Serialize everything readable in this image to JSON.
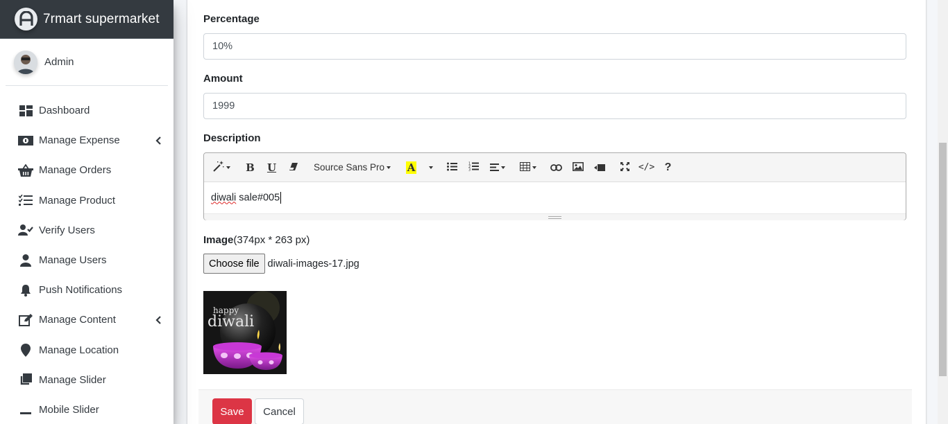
{
  "app": {
    "brand_name": "7rmart supermarket",
    "user_name": "Admin"
  },
  "sidebar": {
    "items": [
      {
        "label": "Dashboard",
        "icon": "dashboard-icon",
        "has_submenu": false
      },
      {
        "label": "Manage Expense",
        "icon": "money-icon",
        "has_submenu": true
      },
      {
        "label": "Manage Orders",
        "icon": "basket-icon",
        "has_submenu": false
      },
      {
        "label": "Manage Product",
        "icon": "tasks-list-icon",
        "has_submenu": false
      },
      {
        "label": "Verify Users",
        "icon": "user-check-icon",
        "has_submenu": false
      },
      {
        "label": "Manage Users",
        "icon": "user-icon",
        "has_submenu": false
      },
      {
        "label": "Push Notifications",
        "icon": "bell-icon",
        "has_submenu": false
      },
      {
        "label": "Manage Content",
        "icon": "edit-icon",
        "has_submenu": true
      },
      {
        "label": "Manage Location",
        "icon": "map-marker-icon",
        "has_submenu": false
      },
      {
        "label": "Manage Slider",
        "icon": "clone-icon",
        "has_submenu": false
      },
      {
        "label": "Mobile Slider",
        "icon": "minus-icon",
        "has_submenu": false
      }
    ]
  },
  "form": {
    "percentage_label": "Percentage",
    "percentage_value": "10%",
    "amount_label": "Amount",
    "amount_value": "1999",
    "description_label": "Description",
    "description_text_misspelled": "diwali",
    "description_text_rest": " sale#005",
    "editor_font": "Source Sans Pro",
    "image_label": "Image",
    "image_hint": "(374px * 263 px)",
    "choose_file_label": "Choose file",
    "file_name": "diwali-images-17.jpg",
    "preview_text_happy": "happy",
    "preview_text_diwali": "diwali"
  },
  "actions": {
    "save_label": "Save",
    "cancel_label": "Cancel"
  },
  "colors": {
    "brand_bg": "#343a40",
    "save_button": "#dc3545",
    "highlight_color": "#ffff00"
  }
}
